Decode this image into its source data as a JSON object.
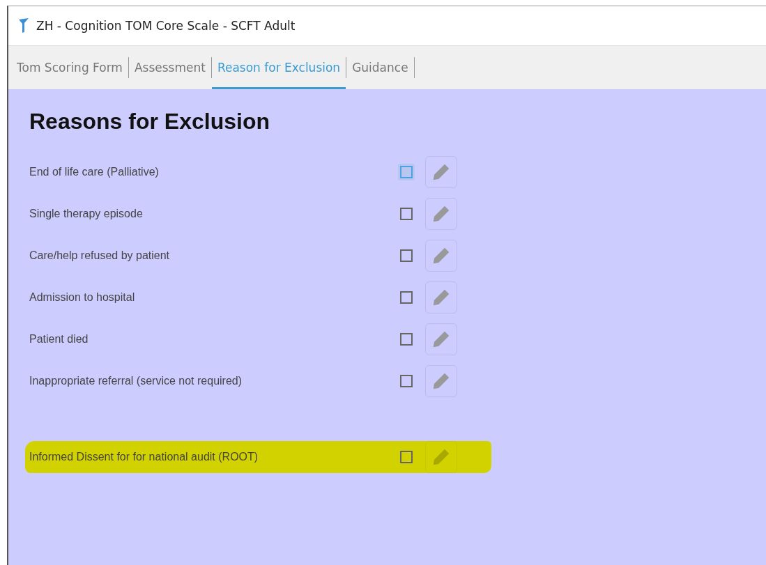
{
  "window": {
    "title": "ZH - Cognition TOM Core Scale - SCFT Adult"
  },
  "tabs": [
    {
      "label": "Tom Scoring Form",
      "selected": false
    },
    {
      "label": "Assessment",
      "selected": false
    },
    {
      "label": "Reason for Exclusion",
      "selected": true
    },
    {
      "label": "Guidance",
      "selected": false
    }
  ],
  "heading": "Reasons for Exclusion",
  "reasons": [
    {
      "label": "End of life care (Palliative)",
      "checked": false,
      "focused": true,
      "highlighted": false
    },
    {
      "label": "Single therapy episode",
      "checked": false,
      "focused": false,
      "highlighted": false
    },
    {
      "label": "Care/help refused by patient",
      "checked": false,
      "focused": false,
      "highlighted": false
    },
    {
      "label": "Admission to hospital",
      "checked": false,
      "focused": false,
      "highlighted": false
    },
    {
      "label": "Patient died",
      "checked": false,
      "focused": false,
      "highlighted": false
    },
    {
      "label": "Inappropriate referral (service not required)",
      "checked": false,
      "focused": false,
      "highlighted": false
    },
    {
      "label": "Informed Dissent for for national audit (ROOT)",
      "checked": false,
      "focused": false,
      "highlighted": true
    }
  ]
}
